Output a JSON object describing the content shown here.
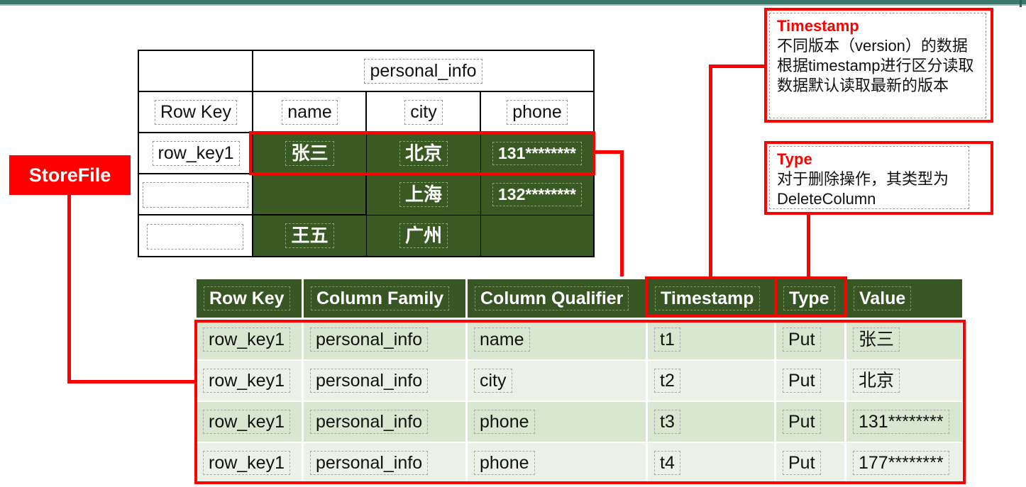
{
  "top_table": {
    "family": "personal_info",
    "row_key_header": "Row Key",
    "columns": [
      "name",
      "city",
      "phone"
    ],
    "rows": [
      {
        "row_key": "row_key1",
        "name": "张三",
        "city": "北京",
        "phone": "131********"
      },
      {
        "row_key": "",
        "name": "",
        "city": "上海",
        "phone": "132********"
      },
      {
        "row_key": "",
        "name": "王五",
        "city": "广州",
        "phone": ""
      }
    ]
  },
  "storefile_label": "StoreFile",
  "timestamp_note": {
    "title": "Timestamp",
    "body": "不同版本（version）的数据根据timestamp进行区分读取数据默认读取最新的版本"
  },
  "type_note": {
    "title": "Type",
    "body": "对于删除操作，其类型为DeleteColumn"
  },
  "bottom_table": {
    "headers": [
      "Row Key",
      "Column Family",
      "Column Qualifier",
      "Timestamp",
      "Type",
      "Value"
    ],
    "rows": [
      [
        "row_key1",
        "personal_info",
        "name",
        "t1",
        "Put",
        "张三"
      ],
      [
        "row_key1",
        "personal_info",
        "city",
        "t2",
        "Put",
        "北京"
      ],
      [
        "row_key1",
        "personal_info",
        "phone",
        "t3",
        "Put",
        "131********"
      ],
      [
        "row_key1",
        "personal_info",
        "phone",
        "t4",
        "Put",
        "177********"
      ]
    ]
  },
  "colors": {
    "cell_green": "#3a5a23",
    "header_green": "#375623",
    "row_light": "#d9e6d0",
    "row_lighter": "#ebf1e6",
    "highlight_red": "#ff0000"
  }
}
